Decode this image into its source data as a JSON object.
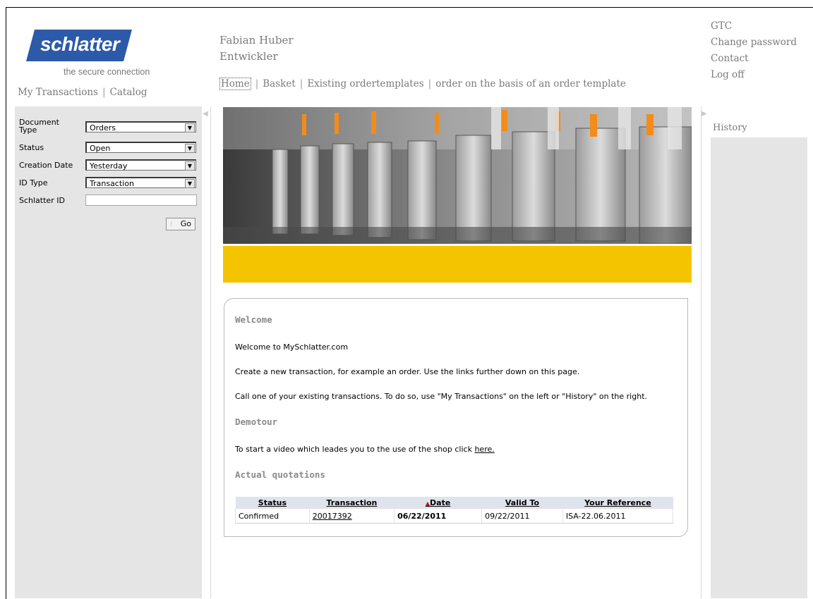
{
  "brand": {
    "logo_text": "schlatter",
    "tagline": "the secure connection",
    "logo_color": "#2c5aa8"
  },
  "user": {
    "name": "Fabian Huber",
    "role": "Entwickler"
  },
  "left_nav": [
    {
      "label": "My Transactions"
    },
    {
      "label": "Catalog"
    }
  ],
  "main_nav": [
    {
      "label": "Home"
    },
    {
      "label": "Basket"
    },
    {
      "label": "Existing ordertemplates"
    },
    {
      "label": "order on the basis of an order template"
    }
  ],
  "utility_links": [
    {
      "label": "GTC"
    },
    {
      "label": "Change password"
    },
    {
      "label": "Contact"
    },
    {
      "label": "Log off"
    }
  ],
  "filters": {
    "document_type": {
      "label_1": "Document",
      "label_2": "Type",
      "value": "Orders"
    },
    "status": {
      "label": "Status",
      "value": "Open"
    },
    "creation_date": {
      "label": "Creation Date",
      "value": "Yesterday"
    },
    "id_type": {
      "label": "ID Type",
      "value": "Transaction"
    },
    "schlatter_id": {
      "label": "Schlatter ID",
      "value": ""
    },
    "go_label": "Go"
  },
  "welcome": {
    "heading": "Welcome",
    "line1": "Welcome to MySchlatter.com",
    "line2": "Create a new transaction, for example an order. Use the links further down on this page.",
    "line3": "Call one of your existing transactions. To do so, use \"My Transactions\" on the left or \"History\" on the right.",
    "demotour_heading": "Demotour",
    "demotour_text": "To start a video which leades you to the use of the shop click ",
    "demotour_link": "here.",
    "quotations_heading": "Actual quotations"
  },
  "quotations": {
    "columns": [
      "Status",
      "Transaction",
      "Date",
      "Valid To",
      "Your Reference"
    ],
    "rows": [
      {
        "status": "Confirmed",
        "transaction": "20017392",
        "date": "06/22/2011",
        "valid_to": "09/22/2011",
        "reference": "ISA-22.06.2011"
      }
    ]
  },
  "history_label": "History",
  "colors": {
    "banner_yellow": "#f5c400",
    "panel_gray": "#e5e5e5",
    "table_header": "#dfe3ec"
  }
}
